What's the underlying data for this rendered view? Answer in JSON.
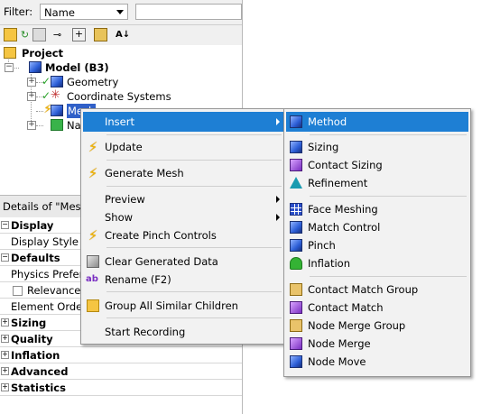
{
  "filter": {
    "label": "Filter:",
    "value": "Name"
  },
  "toolbar": {
    "icons": [
      "project-icon",
      "refresh-icon",
      "wireframe-icon",
      "connect-icon",
      "expand-all-icon",
      "image-icon",
      "sort-az-icon"
    ],
    "sort_glyph": "A↓"
  },
  "tree": {
    "project": "Project",
    "model": "Model (B3)",
    "geometry": "Geometry",
    "coordinate_systems": "Coordinate Systems",
    "mesh": "Mesh",
    "named_selections": "Na"
  },
  "details": {
    "title": "Details of \"Mesh",
    "rows": [
      {
        "label": "Display",
        "group": true
      },
      {
        "label": "Display Style",
        "group": false
      },
      {
        "label": "Defaults",
        "group": true
      },
      {
        "label": "Physics Prefere",
        "group": false
      },
      {
        "label": "Relevance",
        "group": false
      },
      {
        "label": "Element Order",
        "group": false
      },
      {
        "label": "Sizing",
        "group": true
      },
      {
        "label": "Quality",
        "group": true
      },
      {
        "label": "Inflation",
        "group": true
      },
      {
        "label": "Advanced",
        "group": true
      },
      {
        "label": "Statistics",
        "group": true
      }
    ]
  },
  "context_menu": {
    "insert": "Insert",
    "update": "Update",
    "generate_mesh": "Generate Mesh",
    "preview": "Preview",
    "show": "Show",
    "create_pinch_controls": "Create Pinch Controls",
    "clear_generated_data": "Clear Generated Data",
    "rename": "Rename (F2)",
    "group_all_similar_children": "Group All Similar Children",
    "start_recording": "Start Recording"
  },
  "submenu": {
    "method": "Method",
    "sizing": "Sizing",
    "contact_sizing": "Contact Sizing",
    "refinement": "Refinement",
    "face_meshing": "Face Meshing",
    "match_control": "Match Control",
    "pinch": "Pinch",
    "inflation": "Inflation",
    "contact_match_group": "Contact Match Group",
    "contact_match": "Contact Match",
    "node_merge_group": "Node Merge Group",
    "node_merge": "Node Merge",
    "node_move": "Node Move"
  },
  "colors": {
    "highlight": "#1e7fd4",
    "menu_bg": "#f2f2f2",
    "tree_selection": "#3060c8"
  }
}
